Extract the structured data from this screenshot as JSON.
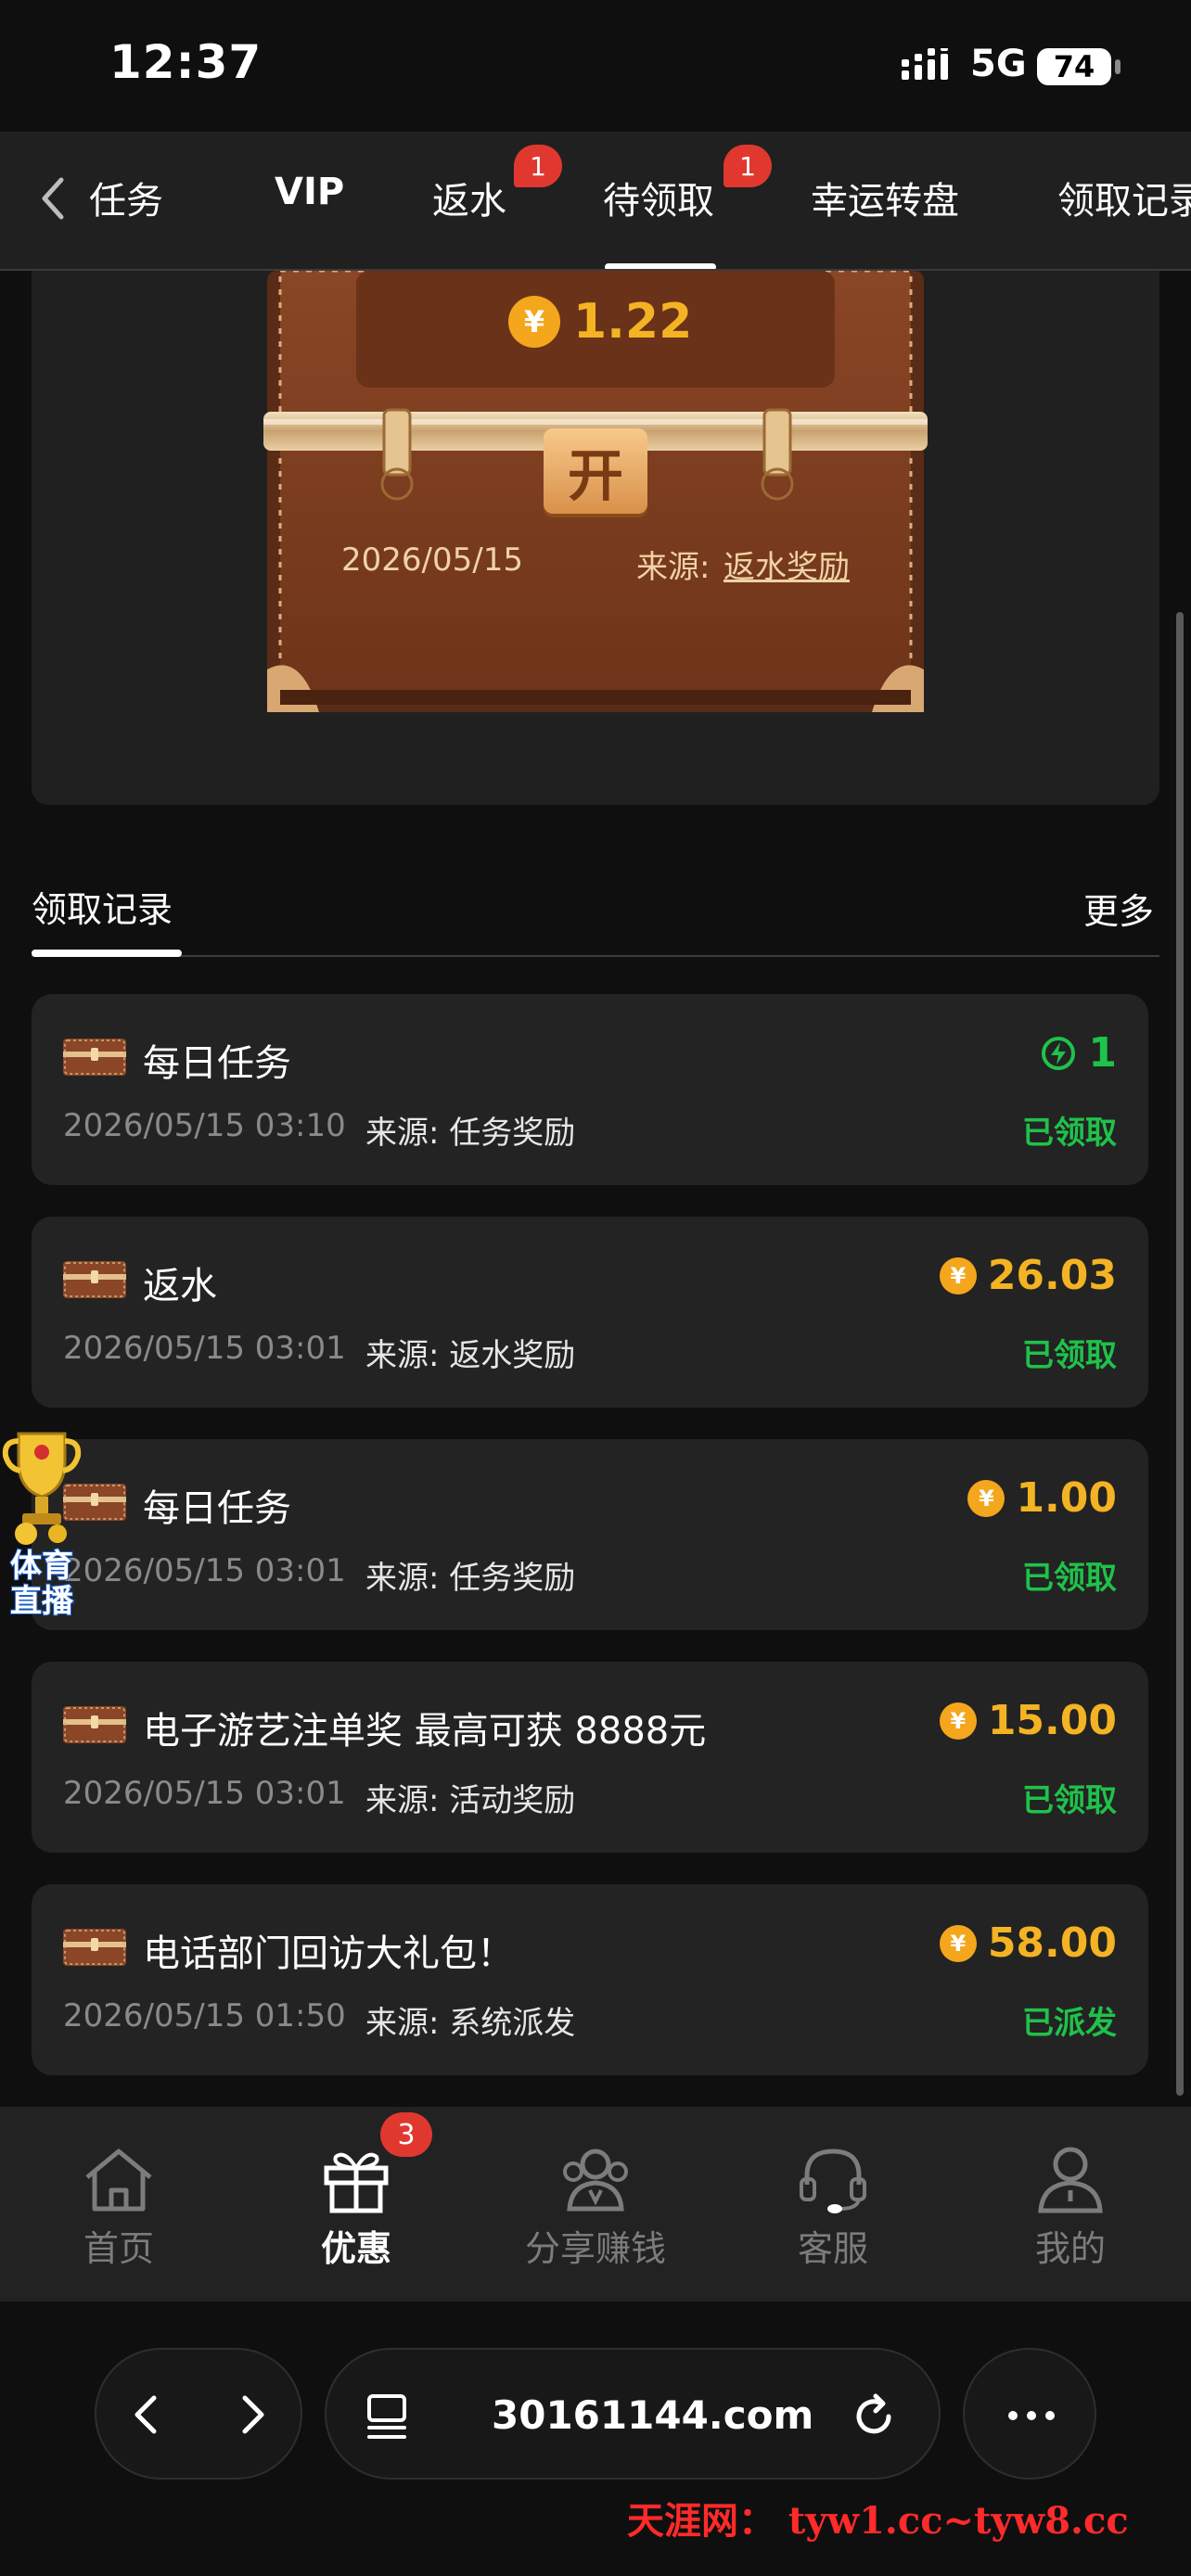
{
  "status_bar": {
    "time": "12:37",
    "network": "5G",
    "battery": "74"
  },
  "tabs": [
    {
      "label": "任务"
    },
    {
      "label": "VIP"
    },
    {
      "label": "返水",
      "badge": "1"
    },
    {
      "label": "待领取",
      "badge": "1",
      "active": true
    },
    {
      "label": "幸运转盘"
    },
    {
      "label": "领取记录"
    }
  ],
  "chest": {
    "amount": "1.22",
    "open_label": "开",
    "date": "2026/05/15",
    "source_label": "来源:",
    "source_value": "返水奖励"
  },
  "records_header": {
    "title": "领取记录",
    "more": "更多"
  },
  "records": [
    {
      "title": "每日任务",
      "date": "2026/05/15 03:10",
      "source": "来源: 任务奖励",
      "amount": "1",
      "amount_type": "energy",
      "status": "已领取"
    },
    {
      "title": "返水",
      "date": "2026/05/15 03:01",
      "source": "来源: 返水奖励",
      "amount": "26.03",
      "amount_type": "coin",
      "status": "已领取"
    },
    {
      "title": "每日任务",
      "date": "2026/05/15 03:01",
      "source": "来源: 任务奖励",
      "amount": "1.00",
      "amount_type": "coin",
      "status": "已领取"
    },
    {
      "title": "电子游艺注单奖 最高可获 8888元",
      "date": "2026/05/15 03:01",
      "source": "来源: 活动奖励",
      "amount": "15.00",
      "amount_type": "coin",
      "status": "已领取"
    },
    {
      "title": "电话部门回访大礼包！",
      "date": "2026/05/15 01:50",
      "source": "来源: 系统派发",
      "amount": "58.00",
      "amount_type": "coin",
      "status": "已派发"
    }
  ],
  "float_widget": {
    "label_line1": "体育",
    "label_line2": "直播"
  },
  "bottom_nav": {
    "items": [
      {
        "label": "首页",
        "icon": "home-icon"
      },
      {
        "label": "优惠",
        "icon": "gift-icon",
        "active": true
      },
      {
        "label": "分享赚钱",
        "icon": "share-icon"
      },
      {
        "label": "客服",
        "icon": "headset-icon"
      },
      {
        "label": "我的",
        "icon": "user-icon"
      }
    ],
    "promo_badge": "3"
  },
  "browser": {
    "url": "30161144.com"
  },
  "watermark": "天涯网： tyw1.cc~tyw8.cc",
  "colors": {
    "gold": "#f4b323",
    "green": "#1fc24a",
    "badge_red": "#e0382f",
    "card_bg": "#232323"
  }
}
